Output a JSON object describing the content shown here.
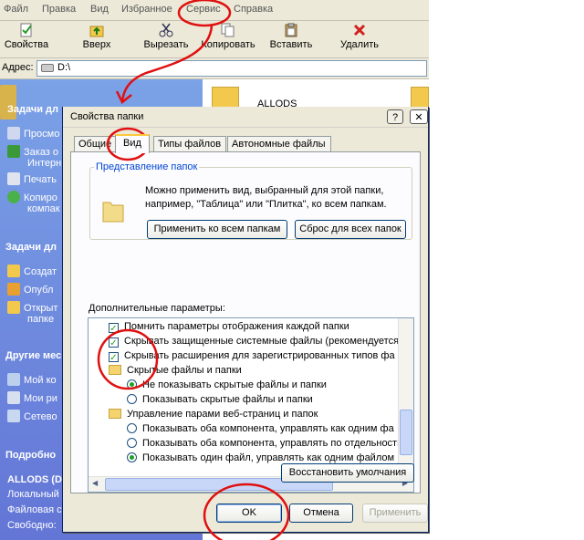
{
  "explorer": {
    "menu": [
      "Файл",
      "Правка",
      "Вид",
      "Избранное",
      "Сервис",
      "Справка"
    ],
    "toolbar": [
      "Свойства",
      "Вверх",
      "Вырезать",
      "Копировать",
      "Вставить",
      "Удалить"
    ],
    "address_label": "Адрес:",
    "address_value": "D:\\",
    "left_pane": {
      "h1": "Задачи дл",
      "items1": [
        "Просмо",
        "Заказ о",
        "Интерн",
        "Печать",
        "Копиро",
        "компак"
      ],
      "h2": "Задачи дл",
      "items2": [
        "Создат",
        "Опубл",
        "Открыт",
        "папке"
      ],
      "h3": "Другие мес",
      "items3": [
        "Мой ко",
        "Мои ри",
        "Сетево"
      ],
      "h4": "Подробно",
      "details": [
        "ALLODS (D:",
        "Локальный",
        "Файловая с",
        "Свободно:"
      ]
    },
    "content_item": "ALLODS"
  },
  "dialog": {
    "title": "Свойства папки",
    "help": "?",
    "close": "✕",
    "tabs": [
      "Общие",
      "Вид",
      "Типы файлов",
      "Автономные файлы"
    ],
    "group_title": "Представление папок",
    "group_text": "Можно применить вид, выбранный для этой папки, например, \"Таблица\" или \"Плитка\", ко всем папкам.",
    "apply_all": "Применить ко всем папкам",
    "reset_all": "Сброс для всех папок",
    "advanced_label": "Дополнительные параметры:",
    "list": [
      "Помнить параметры отображения каждой папки",
      "Скрывать защищенные системные файлы (рекомендуется)",
      "Скрывать расширения для зарегистрированных типов фа",
      "Скрытые файлы и папки",
      "Не показывать скрытые файлы и папки",
      "Показывать скрытые файлы и папки",
      "Управление парами веб-страниц и папок",
      "Показывать оба компонента, управлять как одним фа",
      "Показывать оба компонента, управлять по отдельности",
      "Показывать один файл, управлять как одним файлом"
    ],
    "restore": "Восстановить умолчания",
    "ok": "OK",
    "cancel": "Отмена",
    "apply": "Применить"
  }
}
